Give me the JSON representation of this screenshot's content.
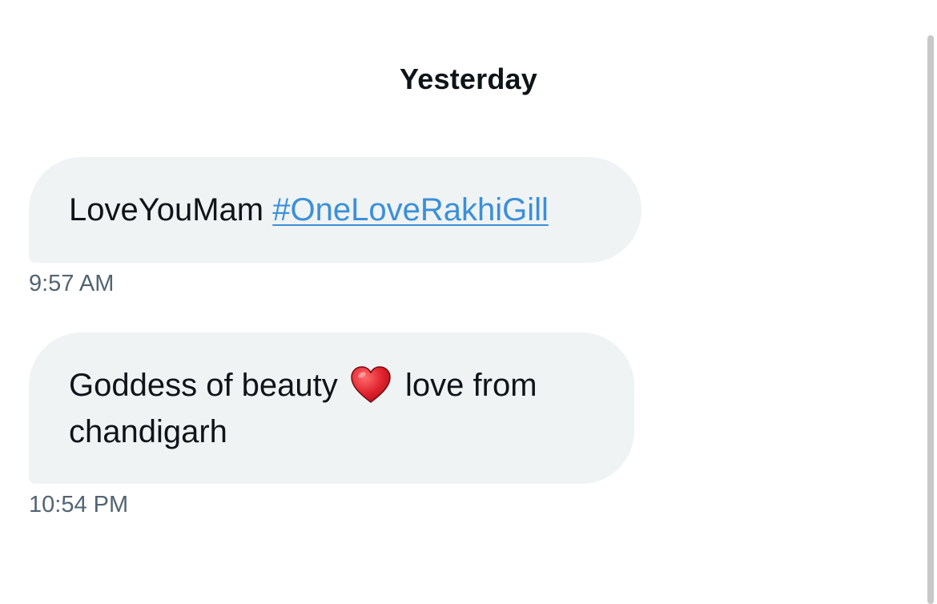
{
  "conversation": {
    "date_divider": "Yesterday",
    "messages": [
      {
        "text": "LoveYouMam ",
        "hashtag": "#OneLoveRakhiGill",
        "time": "9:57 AM"
      },
      {
        "text_before": "Goddess of beauty ",
        "emoji": "heart-emoji",
        "text_after": " love from chandigarh",
        "time": "10:54 PM"
      }
    ]
  },
  "colors": {
    "bubble_background": "#eff3f4",
    "link": "#3b8fd9",
    "timestamp": "#536471",
    "text": "#0f1419",
    "heart": "#e0242f"
  }
}
